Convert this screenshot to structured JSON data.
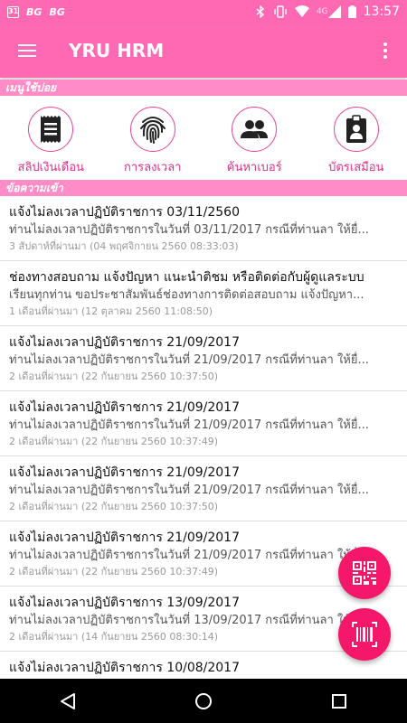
{
  "status_bar": {
    "calendar_day": "31",
    "bg1": "BG",
    "bg2": "BG",
    "network": "4G",
    "time": "13:57",
    "icons": [
      "bluetooth-icon",
      "vibrate-icon",
      "wifi-icon",
      "signal-icon",
      "battery-icon"
    ]
  },
  "appbar": {
    "title": "YRU HRM"
  },
  "sections": {
    "frequent_menu": "เมนูใช้บ่อย",
    "inbox": "ข้อความเข้า"
  },
  "quick_menu": [
    {
      "label": "สลิปเงินเดือน",
      "icon": "receipt-icon"
    },
    {
      "label": "การลงเวลา",
      "icon": "fingerprint-icon"
    },
    {
      "label": "ค้นหาเบอร์",
      "icon": "people-icon"
    },
    {
      "label": "บัตรเสมือน",
      "icon": "badge-icon"
    }
  ],
  "messages": [
    {
      "title": "แจ้งไม่ลงเวลาปฏิบัติราชการ 03/11/2560",
      "body": "ท่านไม่ลงเวลาปฏิบัติราชการในวันที่ 03/11/2017 กรณีที่ท่านลา ให้ยื่...",
      "time": "3 สัปดาห์ที่ผ่านมา (04 พฤศจิกายน 2560 08:33:03)"
    },
    {
      "title": "ช่องทางสอบถาม แจ้งปัญหา แนะนำติชม หรือติดต่อกับผู้ดูแลระบบ",
      "body": "เรียนทุกท่าน ขอประชาสัมพันธ์ช่องทางการติดต่อสอบถาม แจ้งปัญหา...",
      "time": "1 เดือนที่ผ่านมา (12 ตุลาคม 2560 11:08:50)"
    },
    {
      "title": "แจ้งไม่ลงเวลาปฏิบัติราชการ 21/09/2017",
      "body": "ท่านไม่ลงเวลาปฏิบัติราชการในวันที่ 21/09/2017 กรณีที่ท่านลา ให้ยื่...",
      "time": "2 เดือนที่ผ่านมา (22 กันยายน 2560 10:37:50)"
    },
    {
      "title": "แจ้งไม่ลงเวลาปฏิบัติราชการ 21/09/2017",
      "body": "ท่านไม่ลงเวลาปฏิบัติราชการในวันที่ 21/09/2017 กรณีที่ท่านลา ให้ยื่...",
      "time": "2 เดือนที่ผ่านมา (22 กันยายน 2560 10:37:49)"
    },
    {
      "title": "แจ้งไม่ลงเวลาปฏิบัติราชการ 21/09/2017",
      "body": "ท่านไม่ลงเวลาปฏิบัติราชการในวันที่ 21/09/2017 กรณีที่ท่านลา ให้ยื่...",
      "time": "2 เดือนที่ผ่านมา (22 กันยายน 2560 10:37:50)"
    },
    {
      "title": "แจ้งไม่ลงเวลาปฏิบัติราชการ 21/09/2017",
      "body": "ท่านไม่ลงเวลาปฏิบัติราชการในวันที่ 21/09/2017 กรณีที่ท่านลา ให้ยื่...",
      "time": "2 เดือนที่ผ่านมา (22 กันยายน 2560 10:37:49)"
    },
    {
      "title": "แจ้งไม่ลงเวลาปฏิบัติราชการ 13/09/2017",
      "body": "ท่านไม่ลงเวลาปฏิบัติราชการในวันที่ 13/09/2017 กรณีที่ท่านลา ให้ยื่...",
      "time": "2 เดือนที่ผ่านมา (14 กันยายน 2560 08:30:14)"
    },
    {
      "title": "แจ้งไม่ลงเวลาปฏิบัติราชการ 10/08/2017",
      "body": "",
      "time": ""
    }
  ],
  "fabs": [
    {
      "icon": "qr-code-icon"
    },
    {
      "icon": "barcode-icon"
    }
  ],
  "navbar": {
    "icons": [
      "back-icon",
      "home-icon",
      "recents-icon"
    ]
  },
  "colors": {
    "primary": "#ff69b4",
    "section_header": "#ff8cc6",
    "accent": "#f5176a",
    "label": "#e0308a"
  }
}
